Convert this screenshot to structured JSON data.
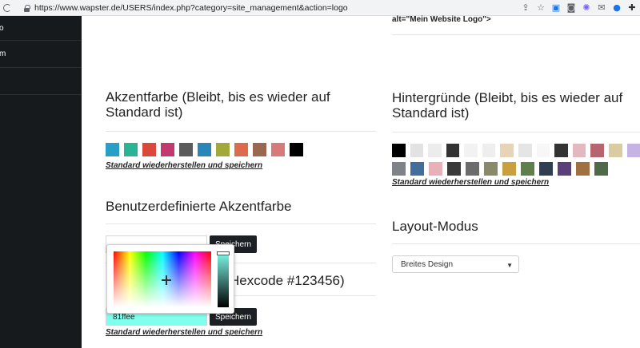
{
  "browser": {
    "url": "https://www.wapster.de/USERS/index.php?category=site_management&action=logo",
    "icons": [
      "share-icon",
      "star-icon",
      "translate-icon",
      "camera-icon",
      "extension-icon",
      "mail-icon",
      "colorwheel-icon",
      "puzzle-icon"
    ]
  },
  "sidebar": {
    "items": [
      {
        "label": "o"
      },
      {
        "label": "m"
      },
      {
        "label": ""
      }
    ]
  },
  "logo_alt": "alt=\"Mein Website Logo\">",
  "accent": {
    "title": "Akzentfarbe (Bleibt, bis es wieder auf Standard ist)",
    "swatches": [
      "#2a9fc6",
      "#2bb394",
      "#d9483b",
      "#c2396e",
      "#5b5b5b",
      "#2b86b8",
      "#a3a83d",
      "#db6b4a",
      "#9a6750",
      "#d97a7a",
      "#000000"
    ],
    "reset_link": "Standard wiederherstellen und speichern"
  },
  "custom_accent": {
    "title": "Benutzerdefinierte Akzentfarbe",
    "field1_value": "",
    "save_label": "Speichern",
    "hexcode_title": "Hexcode #123456)",
    "field2_value": "81ffee",
    "field2_color": "#81ffee",
    "save2_label": "Speichern",
    "reset_link": "Standard wiederherstellen und speichern"
  },
  "backgrounds": {
    "title": "Hintergründe (Bleibt, bis es wieder auf Standard ist)",
    "row1": [
      "#000000",
      "#e2e2e2",
      "#ececec",
      "#333333",
      "#f2f2f2",
      "#eeeeee",
      "#e7d4b7",
      "#e5e5e5",
      "#f7f7f7",
      "#333333",
      "#e4b8c0",
      "#b56470",
      "#d9cca2",
      "#c5b3e6"
    ],
    "row2": [
      "#7f8286",
      "#3f6f9a",
      "#e8b0b8",
      "#3a3a3a",
      "#6c6c6c",
      "#8a8a6a",
      "#c9a040",
      "#5e7e4c",
      "#2f3f50",
      "#5a3f7a",
      "#a07040",
      "#4e6a48"
    ],
    "reset_link": "Standard wiederherstellen und speichern"
  },
  "layout": {
    "title": "Layout-Modus",
    "select_value": "Breites Design"
  }
}
